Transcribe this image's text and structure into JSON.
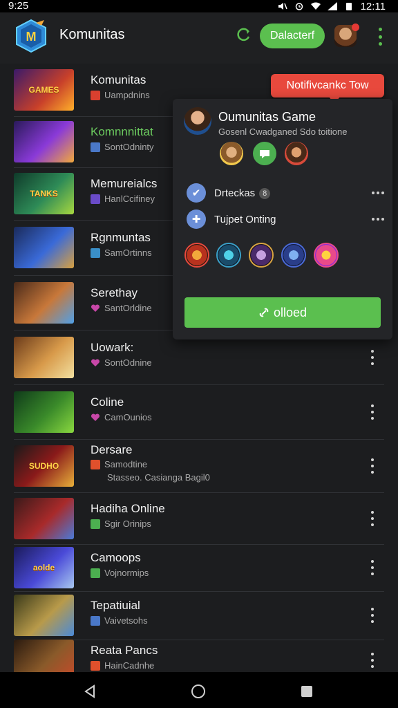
{
  "status_bar": {
    "time": "9:25",
    "clock_right": "12:11"
  },
  "app_bar": {
    "title": "Komunitas",
    "primary_button": "Dalacterf",
    "icons": [
      "app-logo",
      "refresh-icon",
      "user-avatar",
      "more-vert-icon"
    ],
    "accent_color": "#5bbf4f"
  },
  "communities": [
    {
      "title": "Komunitas",
      "subtitle": "Uampdnins",
      "thumb_text": "GAMES",
      "badge_color": "#d9402f",
      "badge_icon": "flame"
    },
    {
      "title": "Komnnnittat",
      "subtitle": "SontOdninty",
      "thumb_text": "",
      "badge_color": "#4a78c8",
      "badge_icon": "square",
      "highlight": true
    },
    {
      "title": "Memureialcs",
      "subtitle": "HanlCcifiney",
      "thumb_text": "TANKS",
      "badge_color": "#6a4bc8",
      "badge_icon": "square"
    },
    {
      "title": "Rgnmuntas",
      "subtitle": "SamOrtinns",
      "thumb_text": "",
      "badge_color": "#3a8fc8",
      "badge_icon": "square"
    },
    {
      "title": "Serethay",
      "subtitle": "SantOrldine",
      "thumb_text": "",
      "badge_color": "#c847a8",
      "badge_icon": "heart"
    },
    {
      "title": "Uowark:",
      "subtitle": "SontOdnine",
      "thumb_text": "",
      "badge_color": "#c847a8",
      "badge_icon": "heart"
    },
    {
      "title": "Coline",
      "subtitle": "CamOunios",
      "thumb_text": "",
      "badge_color": "#c847a8",
      "badge_icon": "heart"
    },
    {
      "title": "Dersare",
      "subtitle": "Samodtine",
      "extra": "Stasseo. Casianga Bagil0",
      "thumb_text": "SUDHO",
      "badge_color": "#e0502c",
      "badge_icon": "flag"
    },
    {
      "title": "Hadiha Online",
      "subtitle": "Sgir Orinips",
      "thumb_text": "",
      "badge_color": "#4caf50",
      "badge_icon": "check"
    },
    {
      "title": "Camoops",
      "subtitle": "Vojnormips",
      "thumb_text": "aolde",
      "badge_color": "#4caf50",
      "badge_icon": "check"
    },
    {
      "title": "Tepatiuial",
      "subtitle": "Vaivetsohs",
      "thumb_text": "",
      "badge_color": "#4a78c8",
      "badge_icon": "square"
    },
    {
      "title": "Reata Pancs",
      "subtitle": "HainCadnhe",
      "thumb_text": "",
      "badge_color": "#e0502c",
      "badge_icon": "flag"
    }
  ],
  "tooltip": {
    "text": "Notifivcankc Tow"
  },
  "popup": {
    "title": "Oumunitas Game",
    "subtitle": "Gosenl Cwadganed Sdo toitione",
    "rows": [
      {
        "label": "Drteckas",
        "badge": "8",
        "icon": "check-circle"
      },
      {
        "label": "Tujpet Onting",
        "icon": "plus-circle"
      }
    ],
    "button": "olloed"
  }
}
